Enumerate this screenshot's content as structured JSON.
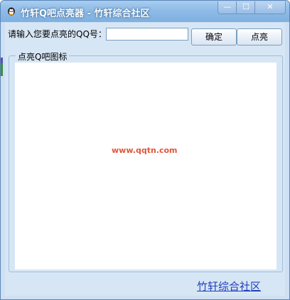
{
  "window": {
    "title": "竹轩Q吧点亮器 - 竹轩综合社区",
    "controls": {
      "minimize": "—",
      "maximize": "☐",
      "close": "✕"
    }
  },
  "form": {
    "qq_label": "请输入您要点亮的QQ号：",
    "qq_value": "",
    "ok_button": "确定",
    "light_button": "点亮"
  },
  "group": {
    "legend": "点亮Q吧图标",
    "watermark": "www.qqtn.com"
  },
  "footer": {
    "link": "竹轩综合社区"
  },
  "colors": {
    "title_bar": "#8fbbe6",
    "client_bg": "#d7e6f5",
    "link": "#1f3fbf",
    "watermark": "#e0553c"
  }
}
